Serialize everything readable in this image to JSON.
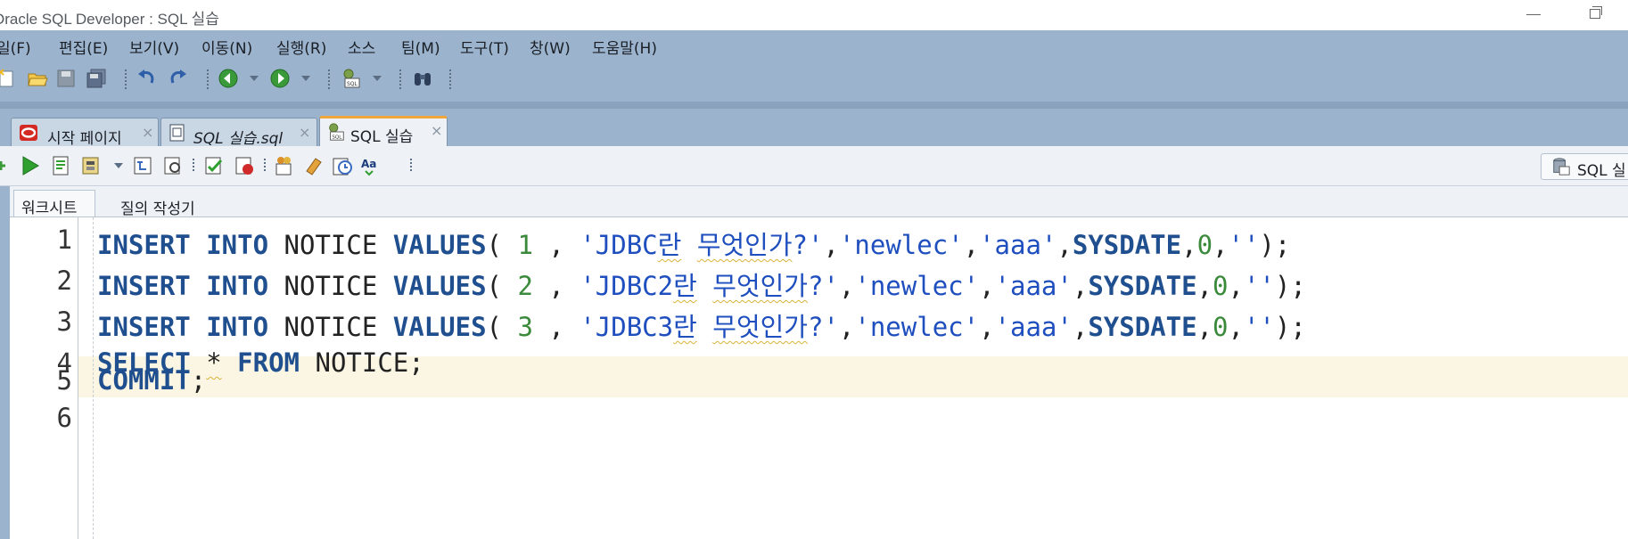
{
  "window": {
    "title": "Oracle SQL Developer : SQL 실습"
  },
  "menu": {
    "items": [
      "일(F)",
      "편집(E)",
      "보기(V)",
      "이동(N)",
      "실행(R)",
      "소스",
      "팀(M)",
      "도구(T)",
      "창(W)",
      "도움말(H)"
    ]
  },
  "tabs": [
    {
      "label": "시작 페이지",
      "close": "×"
    },
    {
      "label": "SQL 실습.sql",
      "close": "×"
    },
    {
      "label": "SQL 실습",
      "close": "×"
    }
  ],
  "editor_toolbar": {
    "right_button_label": "SQL 실"
  },
  "subtabs": [
    "워크시트",
    "질의 작성기"
  ],
  "editor": {
    "lines": [
      {
        "n": "1",
        "text": "INSERT INTO NOTICE VALUES( 1 , 'JDBC란 무엇인가?','newlec','aaa',SYSDATE,0,'');"
      },
      {
        "n": "2",
        "text": "INSERT INTO NOTICE VALUES( 2 , 'JDBC2란 무엇인가?','newlec','aaa',SYSDATE,0,'');"
      },
      {
        "n": "3",
        "text": "INSERT INTO NOTICE VALUES( 3 , 'JDBC3란 무엇인가?','newlec','aaa',SYSDATE,0,'');"
      },
      {
        "n": "4",
        "text": "SELECT * FROM NOTICE;"
      },
      {
        "n": "5",
        "text": "COMMIT;"
      },
      {
        "n": "6",
        "text": ""
      }
    ],
    "current_line": "5"
  },
  "colors": {
    "chrome": "#9bb3cd",
    "keyword": "#1f4f8f",
    "string": "#1f4fbf",
    "number": "#3b8a3b",
    "current_line": "#fbf6e3",
    "active_tab_accent": "#f0a63a"
  }
}
